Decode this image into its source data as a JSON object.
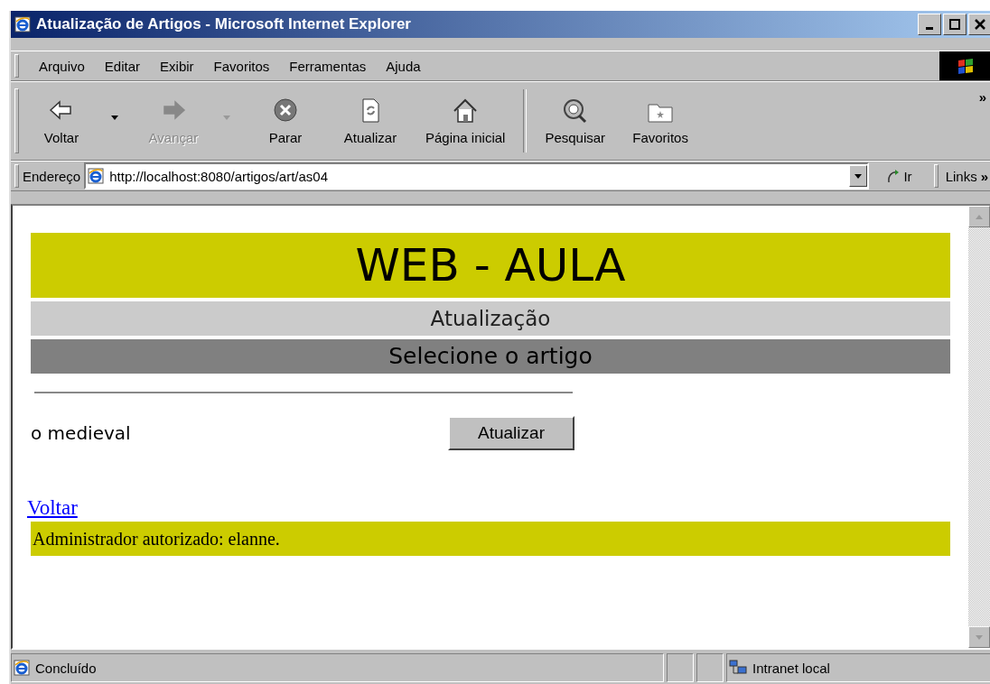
{
  "window": {
    "title": "Atualização de Artigos - Microsoft Internet Explorer"
  },
  "menu": [
    "Arquivo",
    "Editar",
    "Exibir",
    "Favoritos",
    "Ferramentas",
    "Ajuda"
  ],
  "toolbar": [
    {
      "kind": "back",
      "label": "Voltar",
      "disabled": false,
      "dropdown": true
    },
    {
      "kind": "forward",
      "label": "Avançar",
      "disabled": true,
      "dropdown": true
    },
    {
      "kind": "stop",
      "label": "Parar",
      "disabled": false,
      "dropdown": false
    },
    {
      "kind": "refresh",
      "label": "Atualizar",
      "disabled": false,
      "dropdown": false
    },
    {
      "kind": "home",
      "label": "Página inicial",
      "disabled": false,
      "dropdown": false
    },
    {
      "kind": "separator"
    },
    {
      "kind": "search",
      "label": "Pesquisar",
      "disabled": false,
      "dropdown": false
    },
    {
      "kind": "favorites",
      "label": "Favoritos",
      "disabled": false,
      "dropdown": false
    }
  ],
  "toolbar_more": "»",
  "address_bar": {
    "label": "Endereço",
    "value": "http://localhost:8080/artigos/art/as04",
    "go": "Ir",
    "links": "Links",
    "links_more": "»"
  },
  "page": {
    "banner": "WEB - AULA",
    "subtitle": "Atualização",
    "heading": "Selecione o artigo",
    "article": "o medieval",
    "update_button": "Atualizar",
    "back_link": "Voltar",
    "footer": "Administrador autorizado: elanne."
  },
  "status_bar": {
    "text": "Concluído",
    "zone": "Intranet local"
  }
}
